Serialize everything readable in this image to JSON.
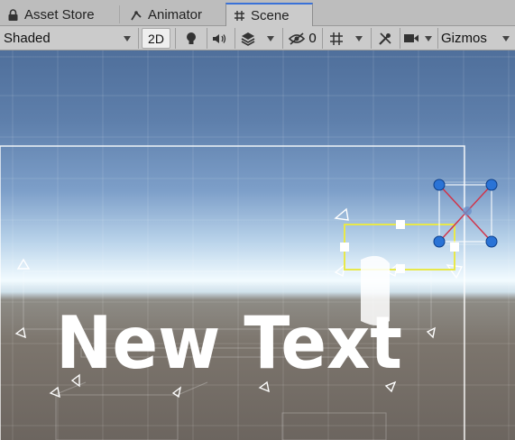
{
  "tabs": [
    {
      "label": "Asset Store",
      "icon": "lock-icon"
    },
    {
      "label": "Animator",
      "icon": "animator-icon"
    },
    {
      "label": "Scene",
      "icon": "hash-icon",
      "active": true
    }
  ],
  "toolbar": {
    "shading_mode": "Shaded",
    "mode_2d_label": "2D",
    "hidden_count": "0",
    "gizmos_label": "Gizmos"
  },
  "scene": {
    "text_object": "New Text"
  },
  "colors": {
    "active_tab_accent": "#3a72d8",
    "selection_yellow": "#e8e84a",
    "gizmo_blue": "#2a73d6",
    "gizmo_red": "#d0354b"
  }
}
